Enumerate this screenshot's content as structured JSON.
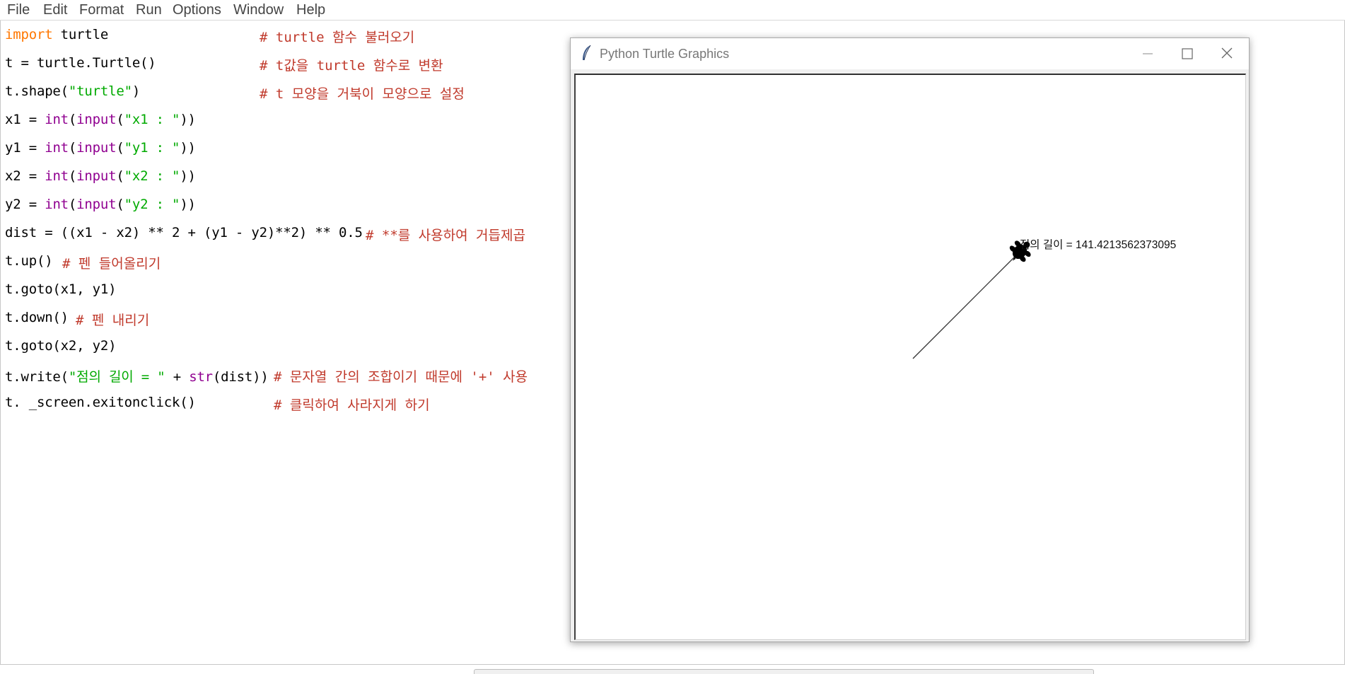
{
  "menubar": {
    "items": [
      "File",
      "Edit",
      "Format",
      "Run",
      "Options",
      "Window",
      "Help"
    ]
  },
  "code": {
    "lines": [
      [
        {
          "t": "import",
          "c": "kw"
        },
        {
          "t": " turtle"
        }
      ],
      [
        {
          "t": "t = turtle.Turtle()"
        }
      ],
      [
        {
          "t": "t.shape("
        },
        {
          "t": "\"turtle\"",
          "c": "str"
        },
        {
          "t": ")"
        }
      ],
      [
        {
          "t": "x1 = "
        },
        {
          "t": "int",
          "c": "bi"
        },
        {
          "t": "("
        },
        {
          "t": "input",
          "c": "bi"
        },
        {
          "t": "("
        },
        {
          "t": "\"x1 : \"",
          "c": "str"
        },
        {
          "t": "))"
        }
      ],
      [
        {
          "t": "y1 = "
        },
        {
          "t": "int",
          "c": "bi"
        },
        {
          "t": "("
        },
        {
          "t": "input",
          "c": "bi"
        },
        {
          "t": "("
        },
        {
          "t": "\"y1 : \"",
          "c": "str"
        },
        {
          "t": "))"
        }
      ],
      [
        {
          "t": "x2 = "
        },
        {
          "t": "int",
          "c": "bi"
        },
        {
          "t": "("
        },
        {
          "t": "input",
          "c": "bi"
        },
        {
          "t": "("
        },
        {
          "t": "\"x2 : \"",
          "c": "str"
        },
        {
          "t": "))"
        }
      ],
      [
        {
          "t": "y2 = "
        },
        {
          "t": "int",
          "c": "bi"
        },
        {
          "t": "("
        },
        {
          "t": "input",
          "c": "bi"
        },
        {
          "t": "("
        },
        {
          "t": "\"y2 : \"",
          "c": "str"
        },
        {
          "t": "))"
        }
      ],
      [
        {
          "t": "dist = ((x1 - x2) ** 2 + (y1 - y2)**2) ** 0.5"
        }
      ],
      [
        {
          "t": "t.up()"
        }
      ],
      [
        {
          "t": "t.goto(x1, y1)"
        }
      ],
      [
        {
          "t": "t.down()"
        }
      ],
      [
        {
          "t": "t.goto(x2, y2)"
        }
      ],
      [
        {
          "t": "t.write("
        },
        {
          "t": "\"점의 길이 = \"",
          "c": "str"
        },
        {
          "t": " + "
        },
        {
          "t": "str",
          "c": "bi"
        },
        {
          "t": "(dist))"
        }
      ],
      [
        {
          "t": "t. _screen.exitonclick()"
        }
      ]
    ],
    "comments": [
      "# turtle 함수 불러오기",
      "# t값을 turtle 함수로 변환",
      "# t 모양을 거북이 모양으로 설정",
      "",
      "",
      "",
      "",
      "# **를 사용하여 거듭제곱",
      "# 펜 들어올리기",
      "",
      "# 펜 내리기",
      "",
      "# 문자열 간의 조합이기 때문에 '+' 사용",
      "# 클릭하여 사라지게 하기"
    ]
  },
  "turtle_window": {
    "title": "Python Turtle Graphics",
    "output_text": "점의 길이 = 141.4213562373095"
  },
  "colors": {
    "keyword": "#ff7700",
    "builtin": "#900090",
    "string": "#00aa00",
    "comment": "#c0392b"
  }
}
